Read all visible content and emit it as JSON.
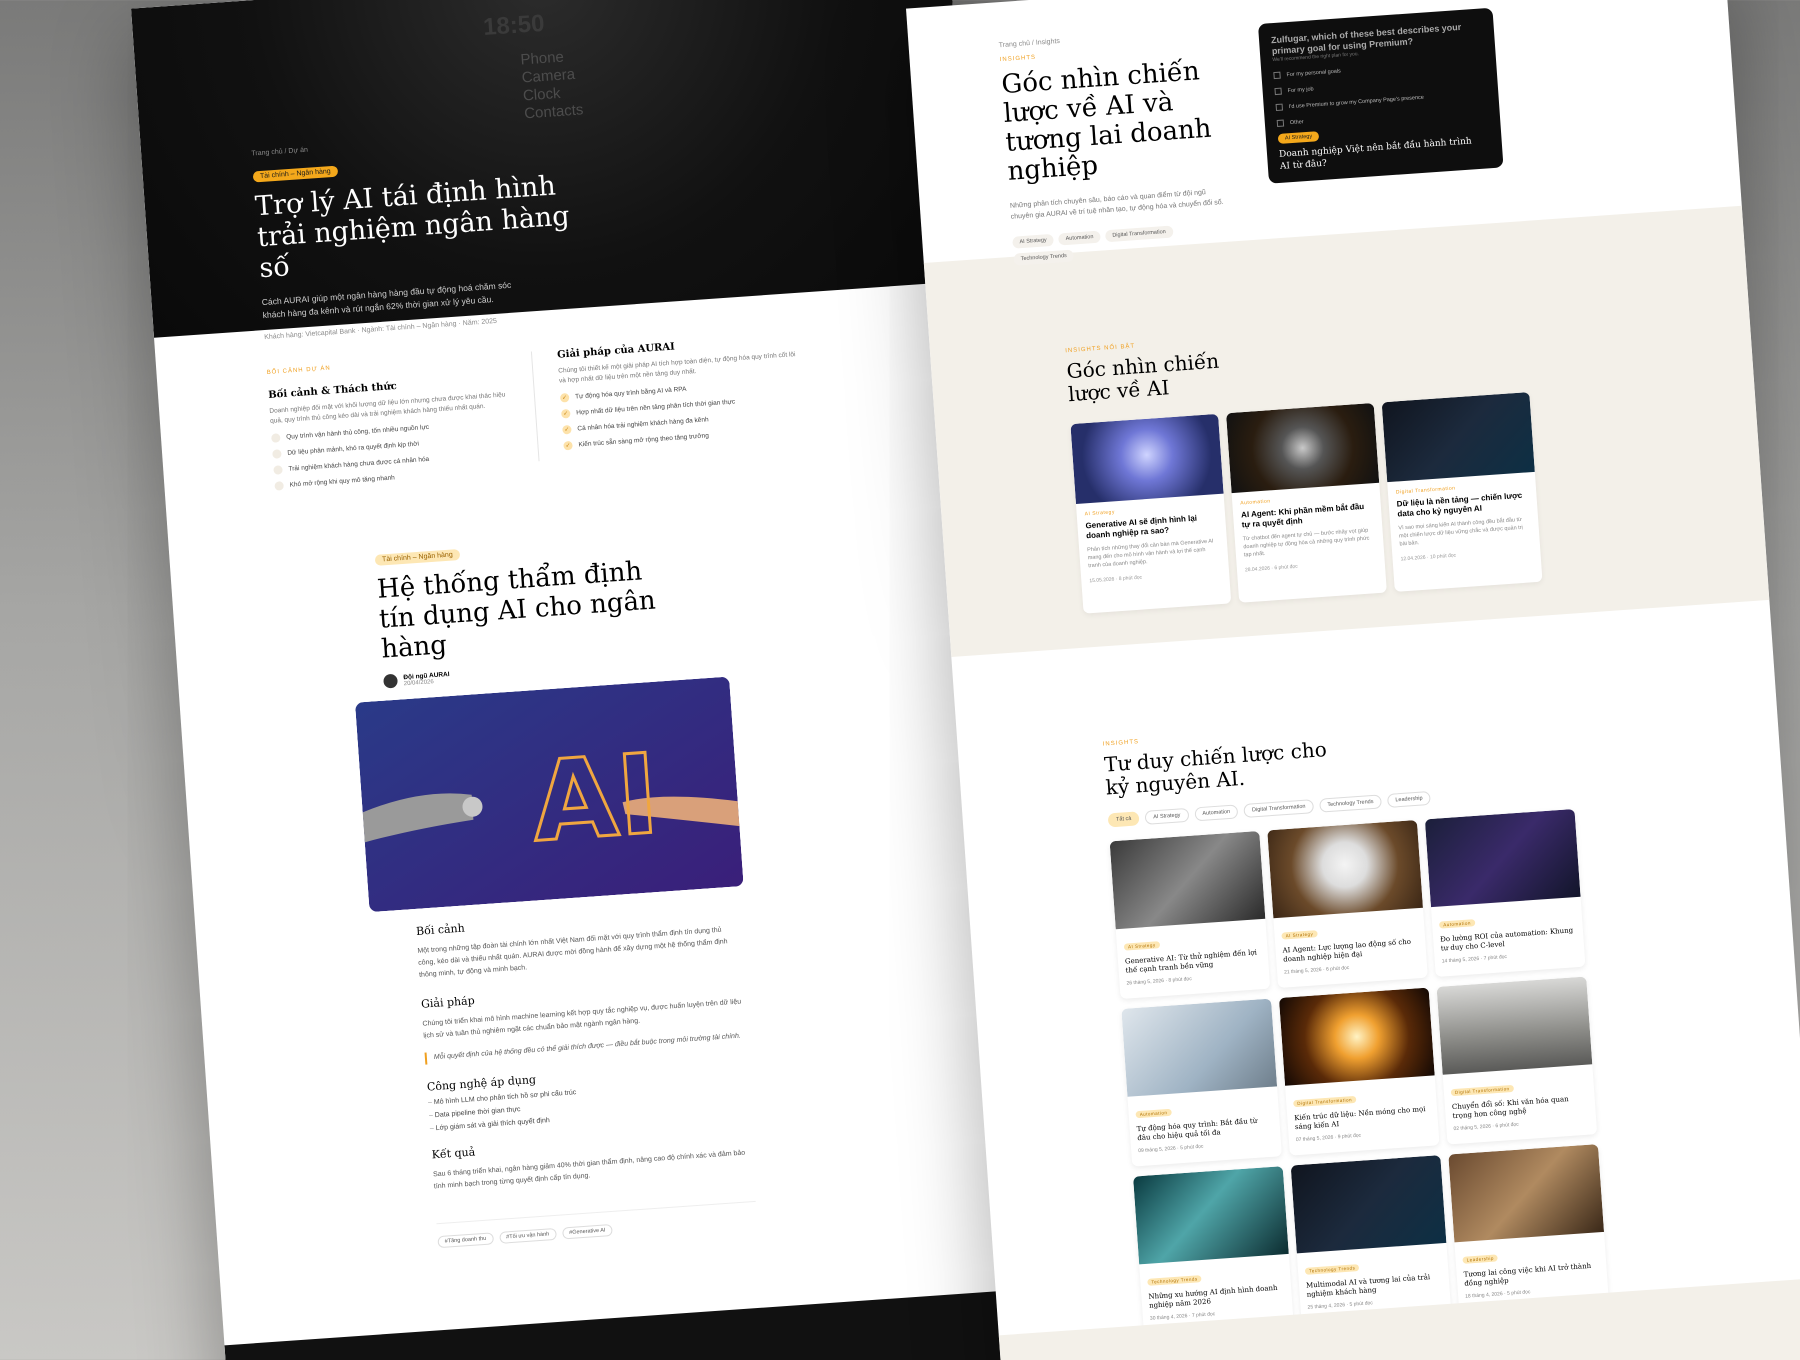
{
  "left": {
    "hero": {
      "phone_time": "18:50",
      "phone_menu": [
        "Phone",
        "Camera",
        "Clock",
        "Contacts"
      ],
      "breadcrumb": [
        "Trang chủ",
        "Dự án"
      ],
      "badge": "Tài chính – Ngân hàng",
      "title": "Trợ lý AI tái định hình trải nghiệm ngân hàng số",
      "description": "Cách AURAI giúp một ngân hàng hàng đầu tự động hoá chăm sóc khách hàng đa kênh và rút ngắn 62% thời gian xử lý yêu cầu.",
      "meta": [
        "Khách hàng: Vietcapital Bank",
        "Ngành: Tài chính – Ngân hàng",
        "Năm: 2025"
      ]
    },
    "context": {
      "eyebrow": "Bối cảnh dự án",
      "challenge_title": "Bối cảnh & Thách thức",
      "challenge_desc": "Doanh nghiệp đối mặt với khối lượng dữ liệu lớn nhưng chưa được khai thác hiệu quả, quy trình thủ công kéo dài và trải nghiệm khách hàng thiếu nhất quán.",
      "challenges": [
        "Quy trình vận hành thủ công, tốn nhiều nguồn lực",
        "Dữ liệu phân mảnh, khó ra quyết định kịp thời",
        "Trải nghiệm khách hàng chưa được cá nhân hóa",
        "Khó mở rộng khi quy mô tăng nhanh"
      ],
      "solution_title": "Giải pháp của AURAI",
      "solution_desc": "Chúng tôi thiết kế một giải pháp AI tích hợp toàn diện, tự động hóa quy trình cốt lõi và hợp nhất dữ liệu trên một nền tảng duy nhất.",
      "solutions": [
        "Tự động hóa quy trình bằng AI và RPA",
        "Hợp nhất dữ liệu trên nền tảng phân tích thời gian thực",
        "Cá nhân hóa trải nghiệm khách hàng đa kênh",
        "Kiến trúc sẵn sàng mở rộng theo tăng trưởng"
      ]
    },
    "article": {
      "badge": "Tài chính – Ngân hàng",
      "title": "Hệ thống thẩm định tín dụng AI cho ngân hàng",
      "author": "Đội ngũ AURAI",
      "date": "20/04/2026",
      "h_context": "Bối cảnh",
      "p_context": "Một trong những tập đoàn tài chính lớn nhất Việt Nam đối mặt với quy trình thẩm định tín dụng thủ công, kéo dài và thiếu nhất quán. AURAI được mời đồng hành để xây dựng một hệ thống thẩm định thông minh, tự động và minh bạch.",
      "h_solution": "Giải pháp",
      "p_solution": "Chúng tôi triển khai mô hình machine learning kết hợp quy tắc nghiệp vụ, được huấn luyện trên dữ liệu lịch sử và tuân thủ nghiêm ngặt các chuẩn bảo mật ngành ngân hàng.",
      "quote": "Mỗi quyết định của hệ thống đều có thể giải thích được — điều bắt buộc trong môi trường tài chính.",
      "h_tech": "Công nghệ áp dụng",
      "tech": [
        "Mô hình LLM cho phân tích hồ sơ phi cấu trúc",
        "Data pipeline thời gian thực",
        "Lớp giám sát và giải thích quyết định"
      ],
      "h_result": "Kết quả",
      "p_result": "Sau 6 tháng triển khai, ngân hàng giảm 40% thời gian thẩm định, nâng cao độ chính xác và đảm bảo tính minh bạch trong từng quyết định cấp tín dụng.",
      "tags": [
        "#Tăng doanh thu",
        "#Tối ưu vận hành",
        "#Generative AI"
      ],
      "image_caption": "AI"
    }
  },
  "right": {
    "breadcrumb": [
      "Trang chủ",
      "Insights"
    ],
    "eyebrow": "Insights",
    "title": "Góc nhìn chiến lược về AI và tương lai doanh nghiệp",
    "description": "Những phân tích chuyên sâu, báo cáo và quan điểm từ đội ngũ chuyên gia AURAI về trí tuệ nhân tạo, tự động hóa và chuyển đổi số.",
    "tags": [
      "AI Strategy",
      "Automation",
      "Digital Transformation",
      "Technology Trends"
    ],
    "survey": {
      "question": "Zulfugar, which of these best describes your primary goal for using Premium?",
      "sub": "We'll recommend the right plan for you.",
      "options": [
        "For my personal goals",
        "For my job",
        "I'd use Premium to grow my Company Page's presence",
        "Other"
      ],
      "badge": "AI Strategy",
      "caption": "Doanh nghiệp Việt nên bắt đầu hành trình AI từ đâu?"
    },
    "featured": {
      "eyebrow": "Insights nổi bật",
      "title": "Góc nhìn chiến lược về AI",
      "cards": [
        {
          "eyebrow": "AI Strategy",
          "title": "Generative AI sẽ định hình lại doanh nghiệp ra sao?",
          "excerpt": "Phân tích những thay đổi căn bản mà Generative AI mang đến cho mô hình vận hành và lợi thế cạnh tranh của doanh nghiệp.",
          "date": "15.05.2026",
          "read": "8 phút đọc"
        },
        {
          "eyebrow": "Automation",
          "title": "AI Agent: Khi phần mềm bắt đầu tự ra quyết định",
          "excerpt": "Từ chatbot đến agent tự chủ — bước nhảy vọt giúp doanh nghiệp tự động hóa cả những quy trình phức tạp nhất.",
          "date": "28.04.2026",
          "read": "6 phút đọc"
        },
        {
          "eyebrow": "Digital Transformation",
          "title": "Dữ liệu là nền tảng — chiến lược data cho kỷ nguyên AI",
          "excerpt": "Vì sao mọi sáng kiến AI thành công đều bắt đầu từ một chiến lược dữ liệu vững chắc và được quản trị bài bản.",
          "date": "12.04.2026",
          "read": "10 phút đọc"
        }
      ]
    },
    "grid": {
      "eyebrow": "Insights",
      "title": "Tư duy chiến lược cho kỷ nguyên AI.",
      "filters": [
        "Tất cả",
        "AI Strategy",
        "Automation",
        "Digital Transformation",
        "Technology Trends",
        "Leadership"
      ],
      "cards": [
        {
          "eyebrow": "AI Strategy",
          "title": "Generative AI: Từ thử nghiệm đến lợi thế cạnh tranh bền vững",
          "date": "26 tháng 5, 2026",
          "read": "8 phút đọc"
        },
        {
          "eyebrow": "AI Strategy",
          "title": "AI Agent: Lực lượng lao động số cho doanh nghiệp hiện đại",
          "date": "21 tháng 5, 2026",
          "read": "6 phút đọc"
        },
        {
          "eyebrow": "Automation",
          "title": "Đo lường ROI của automation: Khung tư duy cho C-level",
          "date": "14 tháng 5, 2026",
          "read": "7 phút đọc"
        },
        {
          "eyebrow": "Automation",
          "title": "Tự động hóa quy trình: Bắt đầu từ đâu cho hiệu quả tối đa",
          "date": "09 tháng 5, 2026",
          "read": "5 phút đọc"
        },
        {
          "eyebrow": "Digital Transformation",
          "title": "Kiến trúc dữ liệu: Nền móng cho mọi sáng kiến AI",
          "date": "07 tháng 5, 2026",
          "read": "9 phút đọc"
        },
        {
          "eyebrow": "Digital Transformation",
          "title": "Chuyển đổi số: Khi văn hóa quan trọng hơn công nghệ",
          "date": "02 tháng 5, 2026",
          "read": "6 phút đọc"
        },
        {
          "eyebrow": "Technology Trends",
          "title": "Những xu hướng AI định hình doanh nghiệp năm 2026",
          "date": "30 tháng 4, 2026",
          "read": "7 phút đọc"
        },
        {
          "eyebrow": "Technology Trends",
          "title": "Multimodal AI và tương lai của trải nghiệm khách hàng",
          "date": "25 tháng 4, 2026",
          "read": "5 phút đọc"
        },
        {
          "eyebrow": "Leadership",
          "title": "Tương lai công việc khi AI trở thành đồng nghiệp",
          "date": "18 tháng 4, 2026",
          "read": "5 phút đọc"
        }
      ]
    }
  }
}
